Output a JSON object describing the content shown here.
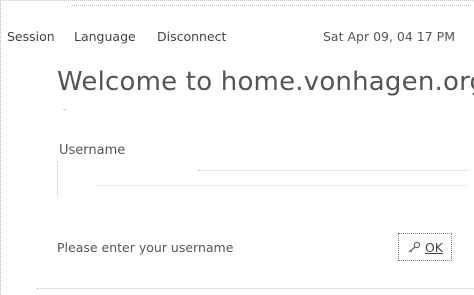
{
  "menu": {
    "session": "Session",
    "language": "Language",
    "disconnect": "Disconnect",
    "clock": "Sat Apr 09, 04 17 PM"
  },
  "title": "Welcome to home.vonhagen.org",
  "login": {
    "username_label": "Username",
    "username_value": "",
    "hint": "Please enter your username",
    "ok_label": "OK",
    "ok_icon": "key-icon"
  }
}
